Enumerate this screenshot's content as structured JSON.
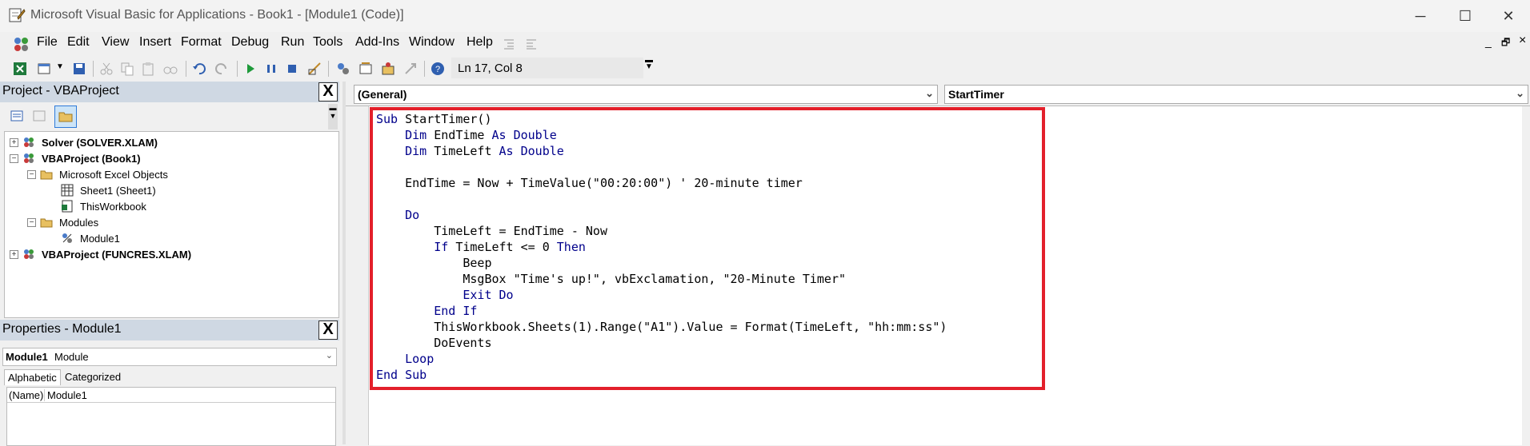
{
  "window": {
    "title": "Microsoft Visual Basic for Applications - Book1 - [Module1 (Code)]",
    "controls": {
      "minimize": "─",
      "maximize": "☐",
      "close": "✕"
    }
  },
  "menu": {
    "items": [
      "File",
      "Edit",
      "View",
      "Insert",
      "Format",
      "Debug",
      "Run",
      "Tools",
      "Add-Ins",
      "Window",
      "Help"
    ],
    "mdi_controls": {
      "minimize": "_",
      "restore": "🗗",
      "close": "×"
    }
  },
  "toolbar": {
    "status": "Ln 17, Col 8"
  },
  "project": {
    "title": "Project - VBAProject",
    "close_label": "X",
    "tree": [
      {
        "label": "Solver (SOLVER.XLAM)",
        "expander": "+",
        "bold": true
      },
      {
        "label": "VBAProject (Book1)",
        "expander": "−",
        "bold": true
      },
      {
        "label": "Microsoft Excel Objects",
        "expander": "−",
        "bold": false
      },
      {
        "label": "Sheet1 (Sheet1)",
        "expander": "",
        "bold": false
      },
      {
        "label": "ThisWorkbook",
        "expander": "",
        "bold": false
      },
      {
        "label": "Modules",
        "expander": "−",
        "bold": false
      },
      {
        "label": "Module1",
        "expander": "",
        "bold": false
      },
      {
        "label": "VBAProject (FUNCRES.XLAM)",
        "expander": "+",
        "bold": true
      }
    ]
  },
  "properties": {
    "title": "Properties - Module1",
    "close_label": "X",
    "object_name": "Module1",
    "object_type": "Module",
    "tabs": [
      "Alphabetic",
      "Categorized"
    ],
    "rows": [
      {
        "name": "(Name)",
        "value": "Module1"
      }
    ]
  },
  "code_window": {
    "object_combo": "(General)",
    "procedure_combo": "StartTimer",
    "highlight_color": "#e3202b",
    "keyword_color": "#00008b"
  },
  "code_lines": [
    [
      [
        "kw",
        "Sub"
      ],
      [
        "t",
        " StartTimer()"
      ]
    ],
    [
      [
        "t",
        "    "
      ],
      [
        "kw",
        "Dim"
      ],
      [
        "t",
        " EndTime "
      ],
      [
        "kw",
        "As Double"
      ]
    ],
    [
      [
        "t",
        "    "
      ],
      [
        "kw",
        "Dim"
      ],
      [
        "t",
        " TimeLeft "
      ],
      [
        "kw",
        "As Double"
      ]
    ],
    [
      [
        "t",
        ""
      ]
    ],
    [
      [
        "t",
        "    EndTime = Now + TimeValue(\"00:20:00\") ' 20-minute timer"
      ]
    ],
    [
      [
        "t",
        ""
      ]
    ],
    [
      [
        "t",
        "    "
      ],
      [
        "kw",
        "Do"
      ]
    ],
    [
      [
        "t",
        "        TimeLeft = EndTime - Now"
      ]
    ],
    [
      [
        "t",
        "        "
      ],
      [
        "kw",
        "If"
      ],
      [
        "t",
        " TimeLeft <= 0 "
      ],
      [
        "kw",
        "Then"
      ]
    ],
    [
      [
        "t",
        "            Beep"
      ]
    ],
    [
      [
        "t",
        "            MsgBox \"Time's up!\", vbExclamation, \"20-Minute Timer\""
      ]
    ],
    [
      [
        "t",
        "            "
      ],
      [
        "kw",
        "Exit Do"
      ]
    ],
    [
      [
        "t",
        "        "
      ],
      [
        "kw",
        "End If"
      ]
    ],
    [
      [
        "t",
        "        ThisWorkbook.Sheets(1).Range(\"A1\").Value = Format(TimeLeft, \"hh:mm:ss\")"
      ]
    ],
    [
      [
        "t",
        "        DoEvents"
      ]
    ],
    [
      [
        "t",
        "    "
      ],
      [
        "kw",
        "Loop"
      ]
    ],
    [
      [
        "kw",
        "End Sub"
      ]
    ]
  ]
}
